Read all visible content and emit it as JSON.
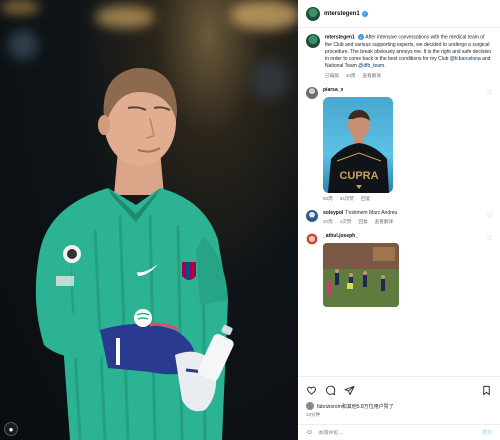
{
  "post": {
    "username": "mterstegen1",
    "caption": {
      "username": "mterstegen1",
      "text": "After intensive conversations with the medical team of the Club and various supporting experts, we decided to undergo a surgical procedure. The break obviously annoys me. It is the right and safe decision in order to come back in the best conditions for my Club",
      "tag1": "@fcbarcelona",
      "and_text": "and National Team",
      "tag2": "@dfb_team",
      "end": "."
    },
    "caption_meta": {
      "edited": "已编辑",
      "time": "40周",
      "translation": "查看翻译"
    }
  },
  "comments": [
    {
      "username": "piarsa_x",
      "text": "",
      "meta": {
        "time": "60周",
        "likes": "34次赞",
        "reply": "回复"
      },
      "image_text": "CUPRA"
    },
    {
      "username": "soleypol",
      "text": "T'estimem Marc Andreu",
      "meta": {
        "time": "40周",
        "likes": "1次赞",
        "reply": "回复",
        "translation": "查看翻译"
      }
    },
    {
      "username": "_athul.joseph_",
      "text": ""
    }
  ],
  "footer": {
    "liked_by": "fabriziorom和其他5.8万位用户赞了",
    "time": "10分钟",
    "add_comment_placeholder": "添加评论...",
    "post_label": "发布"
  },
  "media": {
    "avatar_label": ""
  },
  "colors": {
    "kit": "#2bb393",
    "verified": "#3897f0",
    "link": "#00376b"
  }
}
